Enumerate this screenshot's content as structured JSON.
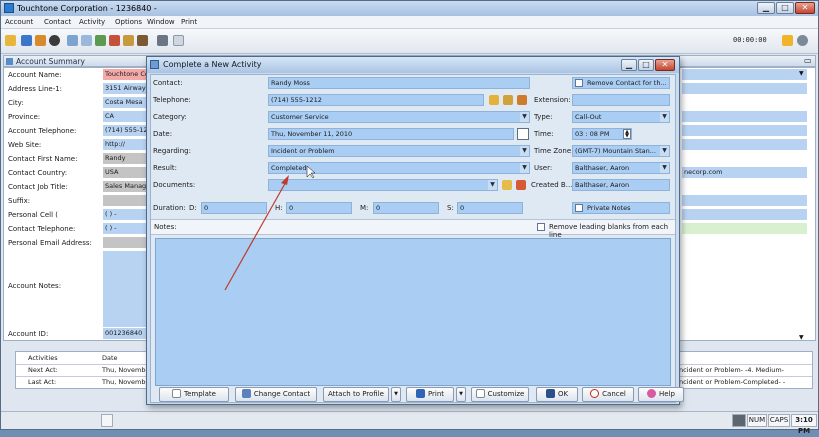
{
  "window": {
    "title": "Touchtone Corporation - 1236840 -"
  },
  "menu": [
    "Account",
    "Contact",
    "Activity",
    "Options",
    "Window",
    "Print"
  ],
  "toolbar": {
    "timer": "00:00:00"
  },
  "summary": {
    "title": "Account Summary",
    "fields": [
      {
        "label": "Account Name:",
        "value": "Touchtone Co"
      },
      {
        "label": "Address Line-1:",
        "value": "3151 Airway A"
      },
      {
        "label": "City:",
        "value": "Costa Mesa"
      },
      {
        "label": "Province:",
        "value": "CA"
      },
      {
        "label": "Account Telephone:",
        "value": "(714) 555-12"
      },
      {
        "label": "Web Site:",
        "value": "http://"
      },
      {
        "label": "Contact First Name:",
        "value": "Randy"
      },
      {
        "label": "Contact Country:",
        "value": "USA"
      },
      {
        "label": "Contact Job Title:",
        "value": "Sales Manage"
      },
      {
        "label": "Suffix:",
        "value": ""
      },
      {
        "label": "Personal Cell (",
        "value": "(  )  -"
      },
      {
        "label": "Contact Telephone:",
        "value": "(  )  -"
      },
      {
        "label": "Personal Email Address:",
        "value": ""
      }
    ],
    "account_notes_label": "Account Notes:",
    "account_id_label": "Account ID:",
    "account_id_value": "001236840",
    "right_email": "necorp.com"
  },
  "activities": {
    "headers": [
      "Activities",
      "Date"
    ],
    "rows": [
      {
        "label": "Next Act:",
        "date": "Thu, November",
        "right": "ncident or Problem- -4. Medium-"
      },
      {
        "label": "Last Act:",
        "date": "Thu, November",
        "right": "ncident or Problem-Completed- -"
      }
    ]
  },
  "status": {
    "num": "NUM",
    "caps": "CAPS",
    "time": "3:10 PM"
  },
  "dialog": {
    "title": "Complete a New Activity",
    "contact_label": "Contact:",
    "contact_value": "Randy Moss",
    "remove_contact": "Remove Contact for th...",
    "telephone_label": "Telephone:",
    "telephone_value": "(714) 555-1212",
    "extension_label": "Extension:",
    "category_label": "Category:",
    "category_value": "Customer Service",
    "type_label": "Type:",
    "type_value": "Call-Out",
    "date_label": "Date:",
    "date_value": "Thu, November 11, 2010",
    "time_label": "Time:",
    "time_value": "03 : 08   PM",
    "regarding_label": "Regarding:",
    "regarding_value": "Incident or Problem",
    "timezone_label": "Time Zone:",
    "timezone_value": "(GMT-7) Mountain Stan...",
    "result_label": "Result:",
    "result_value": "Completed",
    "user_label": "User:",
    "user_value": "Balthaser, Aaron",
    "documents_label": "Documents:",
    "createdby_label": "Created B...",
    "createdby_value": "Balthaser, Aaron",
    "duration_label": "Duration:",
    "d_label": "D:",
    "d_value": "0",
    "h_label": "H:",
    "h_value": "0",
    "m_label": "M:",
    "m_value": "0",
    "s_label": "S:",
    "s_value": "0",
    "private_notes": "Private Notes",
    "notes_label": "Notes:",
    "remove_blanks": "Remove leading blanks from each line",
    "buttons": {
      "template": "Template",
      "change_contact": "Change Contact",
      "attach": "Attach to Profile",
      "print": "Print",
      "customize": "Customize",
      "ok": "OK",
      "cancel": "Cancel",
      "help": "Help"
    }
  },
  "colors": {
    "field_blue": "#a9cdf3",
    "annotation_arrow": "#c0392b"
  }
}
